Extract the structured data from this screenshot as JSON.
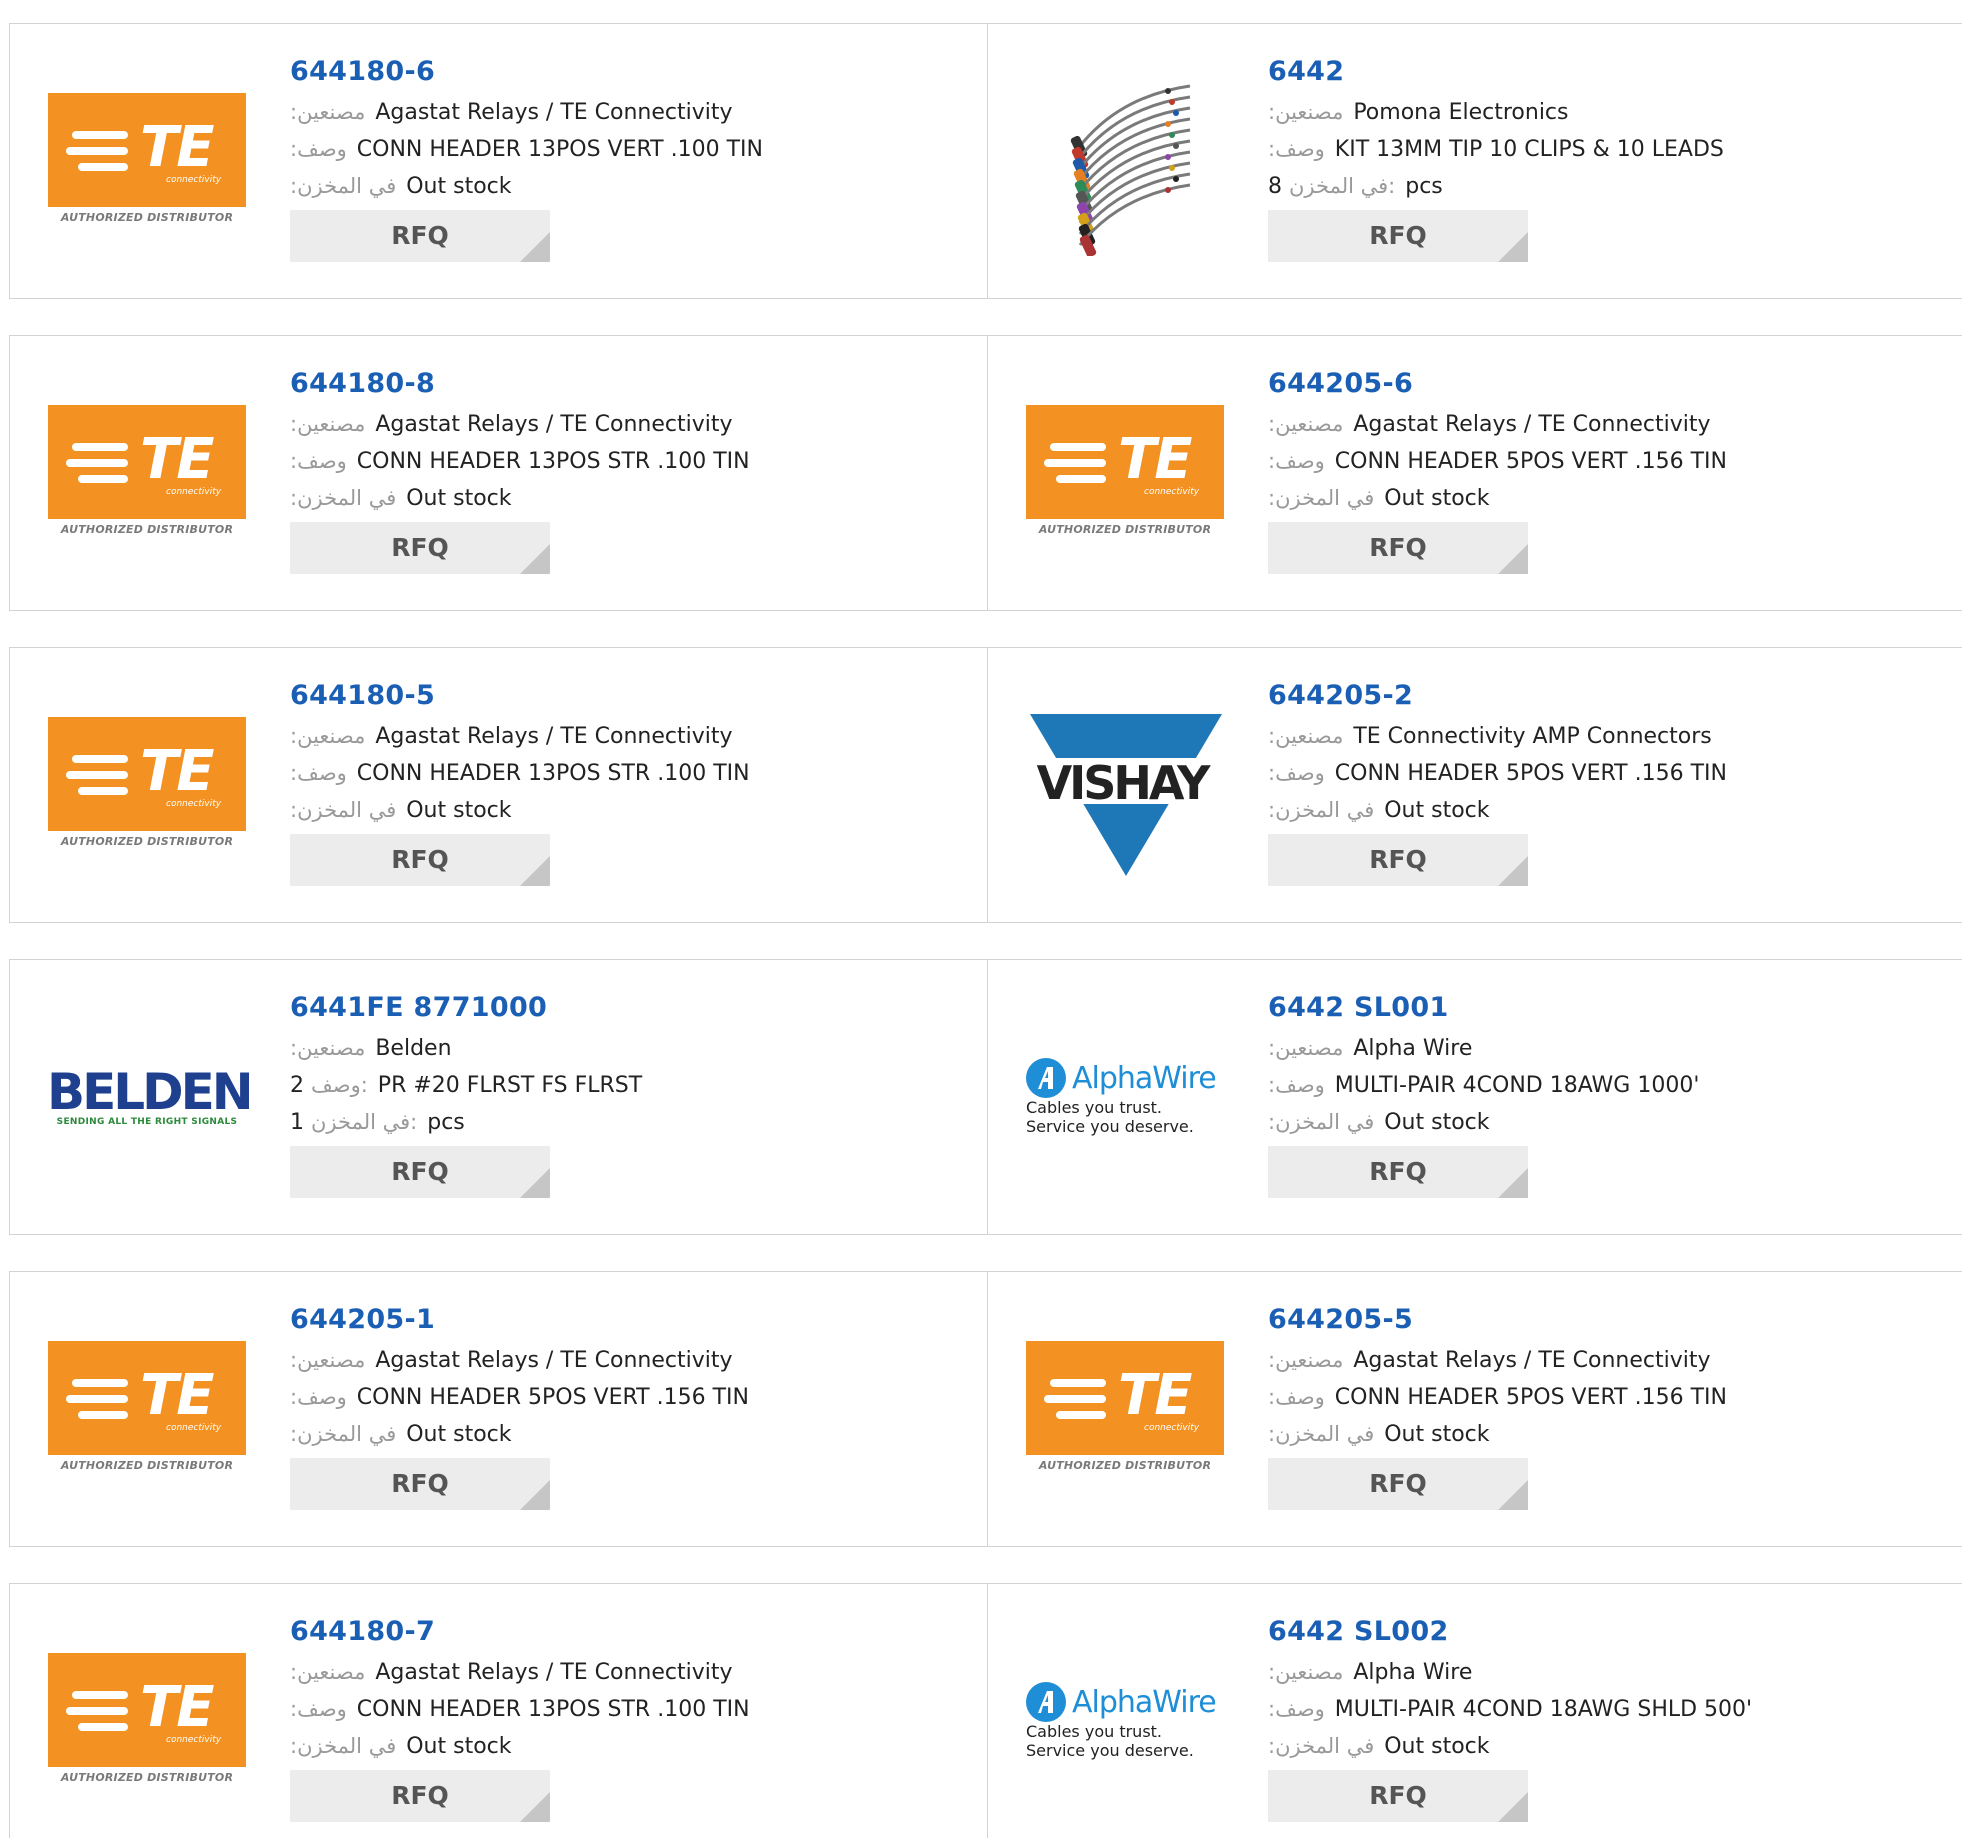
{
  "labels": {
    "manufacturer": ":مصنعين",
    "description": ":وصف",
    "stock": ":في المخزن",
    "stock_qty": "في المخزن:",
    "desc_colon": "وصف:",
    "rfq": "RFQ"
  },
  "logos": {
    "te_word": "TE",
    "te_connectivity": "connectivity",
    "te_authorized": "AUTHORIZED DISTRIBUTOR",
    "vishay": "VISHAY",
    "belden": "BELDEN",
    "belden_tagline": "SENDING ALL THE RIGHT SIGNALS",
    "alphawire": "AlphaWire",
    "alphawire_tagline": "Cables you trust. Service you deserve."
  },
  "products": [
    {
      "part": "644180-6",
      "manufacturer": "Agastat Relays / TE Connectivity",
      "description": "CONN HEADER 13POS VERT .100 TIN",
      "stock": "Out stock",
      "logo": "te"
    },
    {
      "part": "6442",
      "manufacturer": "Pomona Electronics",
      "description": "KIT 13MM TIP 10 CLIPS & 10 LEADS",
      "stock_num": "8",
      "stock_unit": "pcs",
      "logo": "clips"
    },
    {
      "part": "644180-8",
      "manufacturer": "Agastat Relays / TE Connectivity",
      "description": "CONN HEADER 13POS STR .100 TIN",
      "stock": "Out stock",
      "logo": "te"
    },
    {
      "part": "644205-6",
      "manufacturer": "Agastat Relays / TE Connectivity",
      "description": "CONN HEADER 5POS VERT .156 TIN",
      "stock": "Out stock",
      "logo": "te"
    },
    {
      "part": "644180-5",
      "manufacturer": "Agastat Relays / TE Connectivity",
      "description": "CONN HEADER 13POS STR .100 TIN",
      "stock": "Out stock",
      "logo": "te"
    },
    {
      "part": "644205-2",
      "manufacturer": "TE Connectivity AMP Connectors",
      "description": "CONN HEADER 5POS VERT .156 TIN",
      "stock": "Out stock",
      "logo": "vishay"
    },
    {
      "part": "6441FE 8771000",
      "manufacturer": "Belden",
      "description_num": "2",
      "description": "PR #20 FLRST FS FLRST",
      "stock_num": "1",
      "stock_unit": "pcs",
      "logo": "belden"
    },
    {
      "part": "6442 SL001",
      "manufacturer": "Alpha Wire",
      "description": "MULTI-PAIR 4COND 18AWG 1000'",
      "stock": "Out stock",
      "logo": "alpha"
    },
    {
      "part": "644205-1",
      "manufacturer": "Agastat Relays / TE Connectivity",
      "description": "CONN HEADER 5POS VERT .156 TIN",
      "stock": "Out stock",
      "logo": "te"
    },
    {
      "part": "644205-5",
      "manufacturer": "Agastat Relays / TE Connectivity",
      "description": "CONN HEADER 5POS VERT .156 TIN",
      "stock": "Out stock",
      "logo": "te"
    },
    {
      "part": "644180-7",
      "manufacturer": "Agastat Relays / TE Connectivity",
      "description": "CONN HEADER 13POS STR .100 TIN",
      "stock": "Out stock",
      "logo": "te"
    },
    {
      "part": "6442 SL002",
      "manufacturer": "Alpha Wire",
      "description": "MULTI-PAIR 4COND 18AWG SHLD 500'",
      "stock": "Out stock",
      "logo": "alpha"
    }
  ],
  "colors": {
    "part_link": "#1a5fb4",
    "te_orange": "#f39222",
    "vishay_blue": "#1e78b8",
    "belden_blue": "#1f3f8f",
    "alpha_blue": "#1e8ed6",
    "rfq_bg": "#ececec"
  }
}
